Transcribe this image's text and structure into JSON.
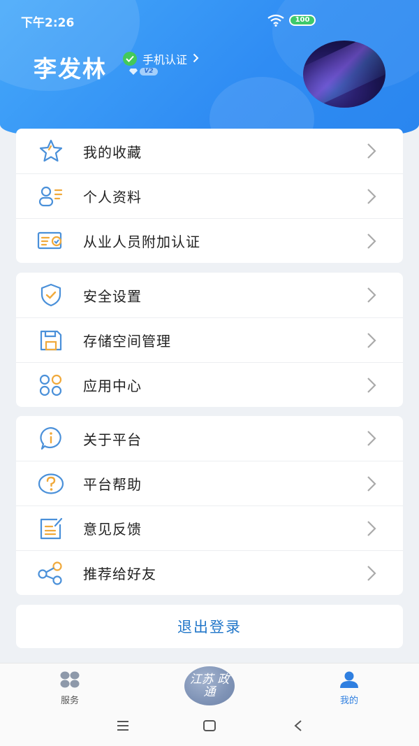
{
  "status_bar": {
    "time": "下午2:26",
    "battery": "100"
  },
  "profile": {
    "name": "李发林",
    "verify_label": "手机认证",
    "level": "V2"
  },
  "menu_groups": [
    {
      "items": [
        {
          "label": "我的收藏",
          "icon": "star-icon"
        },
        {
          "label": "个人资料",
          "icon": "profile-icon"
        },
        {
          "label": "从业人员附加认证",
          "icon": "certificate-icon"
        }
      ]
    },
    {
      "items": [
        {
          "label": "安全设置",
          "icon": "shield-icon"
        },
        {
          "label": "存储空间管理",
          "icon": "storage-icon"
        },
        {
          "label": "应用中心",
          "icon": "apps-icon"
        }
      ]
    },
    {
      "items": [
        {
          "label": "关于平台",
          "icon": "info-icon"
        },
        {
          "label": "平台帮助",
          "icon": "help-icon"
        },
        {
          "label": "意见反馈",
          "icon": "feedback-icon"
        },
        {
          "label": "推荐给好友",
          "icon": "share-icon"
        }
      ]
    }
  ],
  "logout_label": "退出登录",
  "tabbar": {
    "services_label": "服务",
    "center_logo_text": "江苏 政通",
    "mine_label": "我的"
  },
  "colors": {
    "header_blue": "#2f8cf3",
    "accent_blue": "#2277c9",
    "icon_blue": "#4a90d9",
    "icon_orange": "#f0a93b",
    "tab_active": "#2f7fe0"
  }
}
